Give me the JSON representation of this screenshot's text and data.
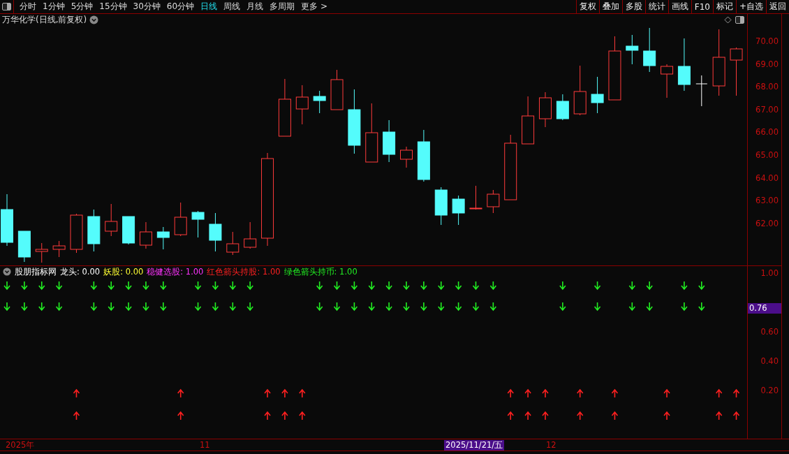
{
  "toolbar": {
    "periods": [
      {
        "label": "分时",
        "selected": false
      },
      {
        "label": "1分钟",
        "selected": false
      },
      {
        "label": "5分钟",
        "selected": false
      },
      {
        "label": "15分钟",
        "selected": false
      },
      {
        "label": "30分钟",
        "selected": false
      },
      {
        "label": "60分钟",
        "selected": false
      },
      {
        "label": "日线",
        "selected": true
      },
      {
        "label": "周线",
        "selected": false
      },
      {
        "label": "月线",
        "selected": false
      },
      {
        "label": "多周期",
        "selected": false
      },
      {
        "label": "更多 >",
        "selected": false
      }
    ],
    "buttons": [
      "复权",
      "叠加",
      "多股",
      "统计",
      "画线",
      "F10",
      "标记",
      "+自选",
      "返回"
    ]
  },
  "price_panel": {
    "title": "万华化学(日线,前复权)",
    "ticks": [
      "70.00",
      "69.00",
      "68.00",
      "67.00",
      "66.00",
      "65.00",
      "64.00",
      "63.00",
      "62.00"
    ]
  },
  "indicator_panel": {
    "name": "股朋指标网",
    "legend": [
      {
        "label": "龙头: 0.00",
        "color": "#ffffff"
      },
      {
        "label": "妖股: 0.00",
        "color": "#ffff33"
      },
      {
        "label": "稳健选股: 1.00",
        "color": "#ff33ff"
      },
      {
        "label": "红色箭头持股: 1.00",
        "color": "#ff2020"
      },
      {
        "label": "绿色箭头持币: 1.00",
        "color": "#22ee22"
      }
    ],
    "ticks": [
      "1.00",
      "0.60",
      "0.40",
      "0.20"
    ],
    "cursor_value": "0.76",
    "signals": [
      {
        "kind": "down"
      },
      {
        "kind": "down"
      },
      {
        "kind": "down"
      },
      {
        "kind": "down"
      },
      {
        "kind": "up"
      },
      {
        "kind": "down"
      },
      {
        "kind": "down"
      },
      {
        "kind": "down"
      },
      {
        "kind": "down"
      },
      {
        "kind": "down"
      },
      {
        "kind": "up"
      },
      {
        "kind": "down"
      },
      {
        "kind": "down"
      },
      {
        "kind": "down"
      },
      {
        "kind": "down"
      },
      {
        "kind": "up"
      },
      {
        "kind": "up"
      },
      {
        "kind": "up"
      },
      {
        "kind": "down"
      },
      {
        "kind": "down"
      },
      {
        "kind": "down"
      },
      {
        "kind": "down"
      },
      {
        "kind": "down"
      },
      {
        "kind": "down"
      },
      {
        "kind": "down"
      },
      {
        "kind": "down"
      },
      {
        "kind": "down"
      },
      {
        "kind": "down"
      },
      {
        "kind": "down"
      },
      {
        "kind": "up"
      },
      {
        "kind": "up"
      },
      {
        "kind": "up"
      },
      {
        "kind": "down"
      },
      {
        "kind": "up"
      },
      {
        "kind": "down"
      },
      {
        "kind": "up"
      },
      {
        "kind": "down"
      },
      {
        "kind": "down"
      },
      {
        "kind": "up"
      },
      {
        "kind": "down"
      },
      {
        "kind": "down"
      },
      {
        "kind": "up"
      },
      {
        "kind": "up"
      }
    ]
  },
  "date_axis": {
    "labels": [
      {
        "text": "2025年",
        "selected": false
      },
      {
        "text": "11",
        "selected": false
      },
      {
        "text": "2025/11/21/五",
        "selected": true
      },
      {
        "text": "12",
        "selected": false
      }
    ]
  }
}
